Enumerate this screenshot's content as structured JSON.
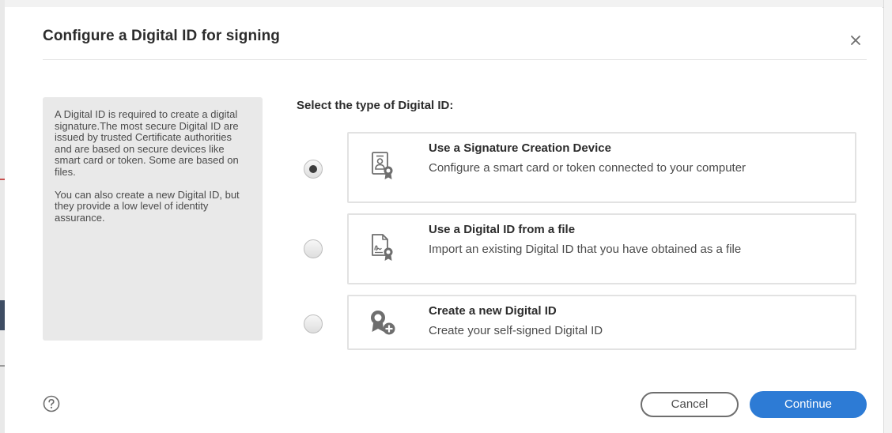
{
  "dialog": {
    "title": "Configure a Digital ID for signing",
    "close_icon": "close-icon"
  },
  "info_panel": {
    "paragraph_1": "A Digital ID is required to create a digital signature.The most secure Digital ID are issued by trusted Certificate authorities and are based on secure devices like smart card or token. Some are based on files.",
    "paragraph_2": "You can also create a new Digital ID, but they provide a low level of identity assurance."
  },
  "selection": {
    "heading": "Select the type of Digital ID:",
    "selected_index": 0,
    "options": [
      {
        "title": "Use a Signature Creation Device",
        "description": "Configure a smart card or token connected to your computer",
        "icon": "signature-device-icon"
      },
      {
        "title": "Use a Digital ID from a file",
        "description": "Import an existing Digital ID that you have obtained as a file",
        "icon": "digital-id-file-icon"
      },
      {
        "title": "Create a new Digital ID",
        "description": "Create your self-signed Digital ID",
        "icon": "new-digital-id-icon"
      }
    ]
  },
  "footer": {
    "help_icon": "help-icon",
    "cancel_label": "Cancel",
    "continue_label": "Continue"
  },
  "colors": {
    "primary_button": "#2d7bd5",
    "panel_background": "#e9e9e9",
    "card_border": "#e2e2e2",
    "heading_text": "#2c2c2c",
    "body_text": "#4b4b4b"
  }
}
